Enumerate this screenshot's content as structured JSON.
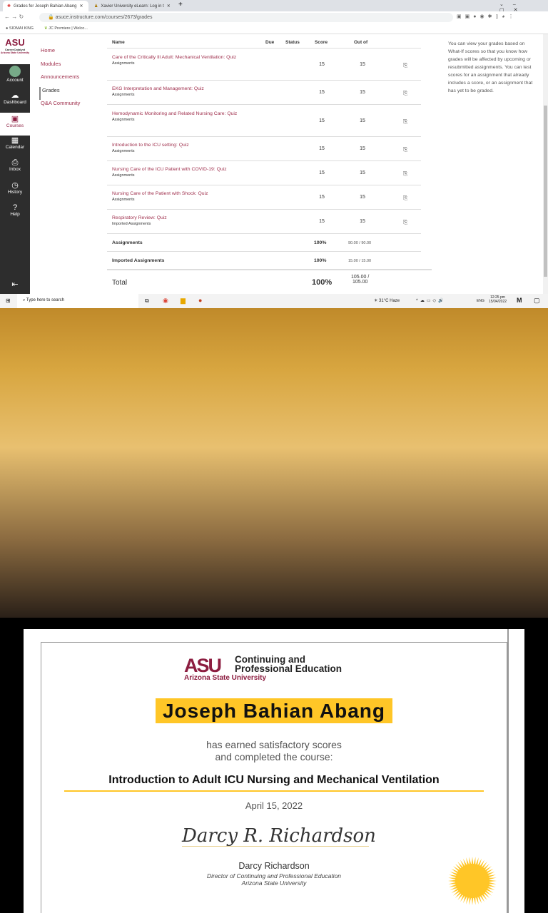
{
  "browser": {
    "tabs": [
      {
        "label": "Grades for Joseph Bahian Abang"
      },
      {
        "label": "Xavier University eLearn: Log in t"
      }
    ],
    "url": "asuce.instructure.com/courses/2673/grades",
    "bookmarks": [
      "SIOMAI KING",
      "JC Premiere | Welco..."
    ]
  },
  "global_nav": {
    "logo": "ASU",
    "logo_sub1": "CareerCatalyst",
    "logo_sub2": "Arizona State University",
    "items": [
      {
        "label": "Account",
        "icon": "avatar"
      },
      {
        "label": "Dashboard",
        "icon": "dashboard-icon"
      },
      {
        "label": "Courses",
        "icon": "courses-icon"
      },
      {
        "label": "Calendar",
        "icon": "calendar-icon"
      },
      {
        "label": "Inbox",
        "icon": "inbox-icon"
      },
      {
        "label": "History",
        "icon": "history-icon"
      },
      {
        "label": "Help",
        "icon": "help-icon"
      }
    ]
  },
  "course_nav": [
    "Home",
    "Modules",
    "Announcements",
    "Grades",
    "Q&A Community"
  ],
  "grades": {
    "headers": {
      "name": "Name",
      "due": "Due",
      "status": "Status",
      "score": "Score",
      "out_of": "Out of"
    },
    "rows": [
      {
        "name": "Care of the Critically Ill Adult: Mechanical Ventilation: Quiz",
        "group": "Assignments",
        "score": "15",
        "out_of": "15"
      },
      {
        "name": "EKG Interpretation and Management: Quiz",
        "group": "Assignments",
        "score": "15",
        "out_of": "15"
      },
      {
        "name": "Hemodynamic Monitoring and Related Nursing Care: Quiz",
        "group": "Assignments",
        "score": "15",
        "out_of": "15"
      },
      {
        "name": "Introduction to the ICU setting: Quiz",
        "group": "Assignments",
        "score": "15",
        "out_of": "15"
      },
      {
        "name": "Nursing Care of the ICU Patient with COVID-19: Quiz",
        "group": "Assignments",
        "score": "15",
        "out_of": "15"
      },
      {
        "name": "Nursing Care of the Patient with Shock: Quiz",
        "group": "Assignments",
        "score": "15",
        "out_of": "15"
      },
      {
        "name": "Respiratory Review: Quiz",
        "group": "Imported Assignments",
        "score": "15",
        "out_of": "15"
      }
    ],
    "groups": [
      {
        "name": "Assignments",
        "pct": "100%",
        "pts": "90.00 / 90.00"
      },
      {
        "name": "Imported Assignments",
        "pct": "100%",
        "pts": "15.00 / 15.00"
      }
    ],
    "total": {
      "label": "Total",
      "pct": "100%",
      "pts1": "105.00 /",
      "pts2": "105.00"
    }
  },
  "info": "You can view your grades based on What-If scores so that you know how grades will be affected by upcoming or resubmitted assignments. You can test scores for an assignment that already includes a score, or an assignment that has yet to be graded.",
  "taskbar": {
    "search": "Type here to search",
    "weather": "31°C Haze",
    "lang": "ENG",
    "time": "12:25 pm",
    "date": "15/04/2022"
  },
  "certificate": {
    "logo": "ASU",
    "org1": "Continuing and",
    "org2": "Professional Education",
    "university": "Arizona State University",
    "recipient": "Joseph Bahian Abang",
    "line1": "has earned satisfactory scores",
    "line2": "and completed the course:",
    "course": "Introduction to Adult ICU Nursing and Mechanical Ventilation",
    "date": "April 15, 2022",
    "signature": "Darcy Richardson",
    "signer": "Darcy Richardson",
    "signer_title": "Director of Continuing and Professional Education",
    "signer_org": "Arizona State University"
  }
}
